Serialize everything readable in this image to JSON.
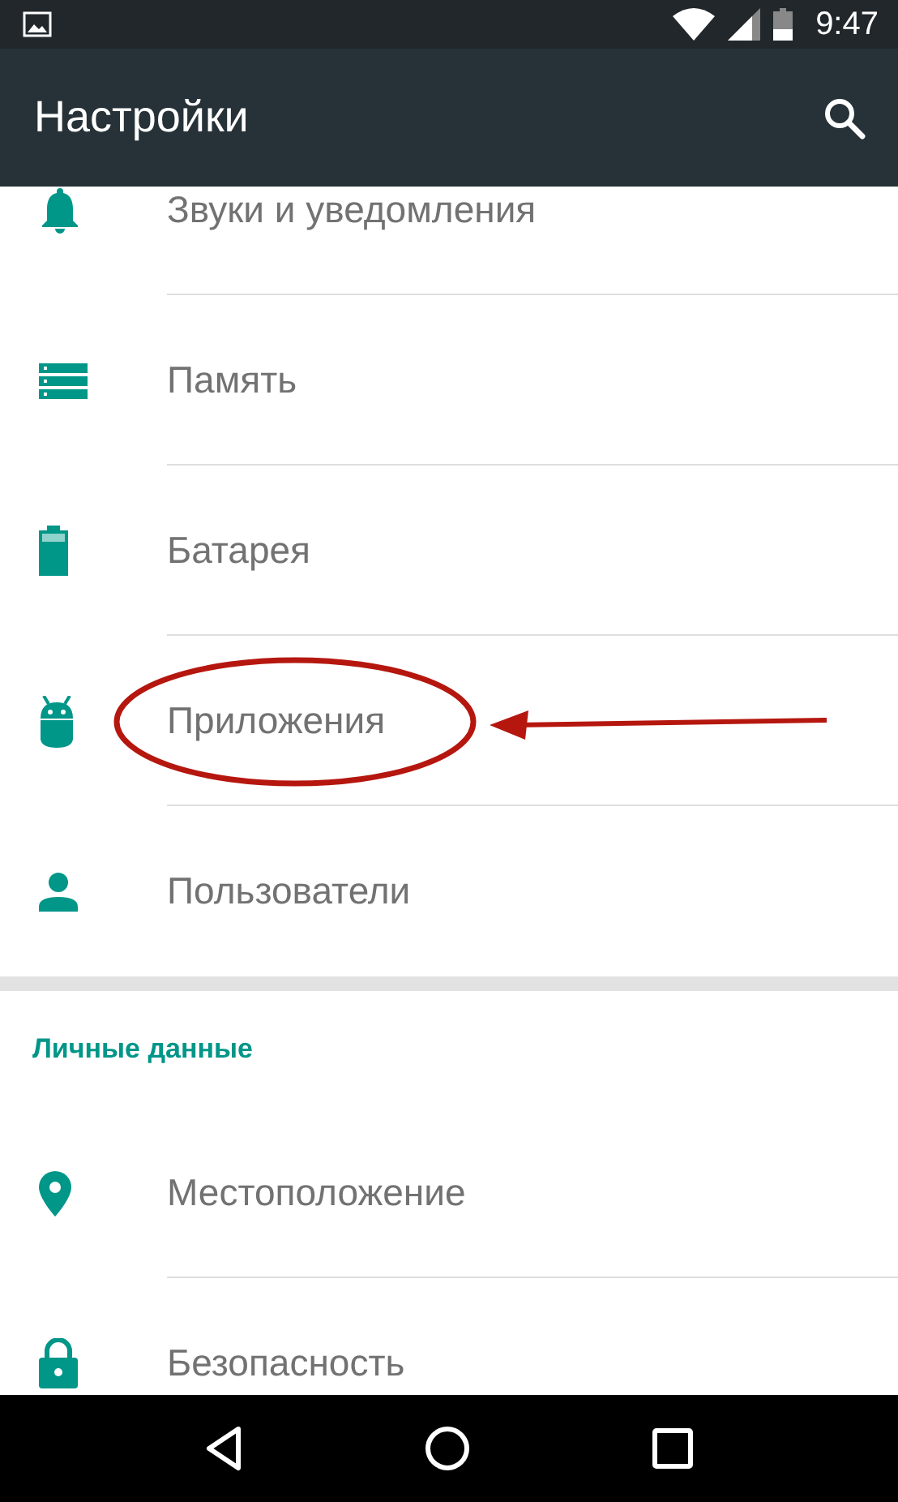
{
  "status_bar": {
    "time": "9:47"
  },
  "app_bar": {
    "title": "Настройки"
  },
  "sections": [
    {
      "items": [
        {
          "label": "Звуки и уведомления",
          "kind": "bell",
          "annotated": false
        },
        {
          "label": "Память",
          "kind": "storage",
          "annotated": false
        },
        {
          "label": "Батарея",
          "kind": "battery",
          "annotated": false
        },
        {
          "label": "Приложения",
          "kind": "android",
          "annotated": true
        },
        {
          "label": "Пользователи",
          "kind": "person",
          "annotated": false
        }
      ]
    },
    {
      "header": "Личные данные",
      "items": [
        {
          "label": "Местоположение",
          "kind": "location",
          "annotated": false
        },
        {
          "label": "Безопасность",
          "kind": "lock",
          "annotated": false
        }
      ]
    }
  ]
}
